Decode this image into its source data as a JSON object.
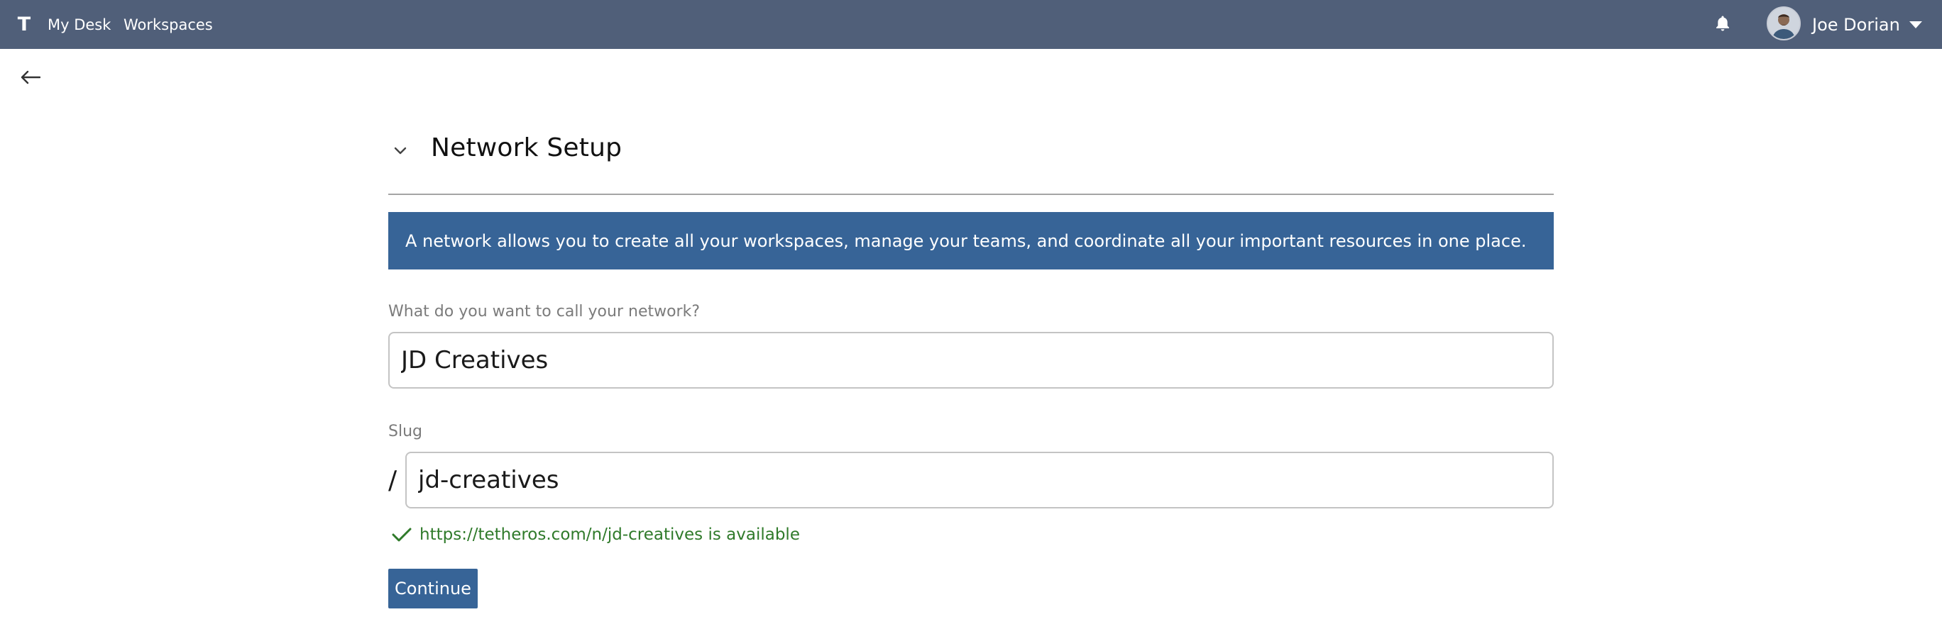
{
  "header": {
    "brand_icon": "tetheros-t-logo",
    "brand_letter": "T",
    "nav": [
      {
        "label": "My Desk"
      },
      {
        "label": "Workspaces"
      }
    ],
    "notifications_icon": "bell-icon",
    "user": {
      "name": "Joe Dorian",
      "avatar_icon": "user-avatar",
      "menu_icon": "caret-down-icon"
    }
  },
  "back_icon": "arrow-left-icon",
  "section": {
    "toggle_icon": "chevron-down-icon",
    "title": "Network Setup"
  },
  "banner": {
    "text": "A network allows you to create all your workspaces, manage your teams, and coordinate all your important resources in one place."
  },
  "form": {
    "name_label": "What do you want to call your network?",
    "name_value": "JD Creatives",
    "slug_label": "Slug",
    "slug_prefix": "/",
    "slug_value": "jd-creatives",
    "availability_icon": "check-icon",
    "availability_text": "https://tetheros.com/n/jd-creatives is available",
    "continue_label": "Continue"
  },
  "colors": {
    "topbar": "#505f79",
    "primary": "#376497",
    "success": "#2f7a2a",
    "label": "#7b7b7b"
  }
}
